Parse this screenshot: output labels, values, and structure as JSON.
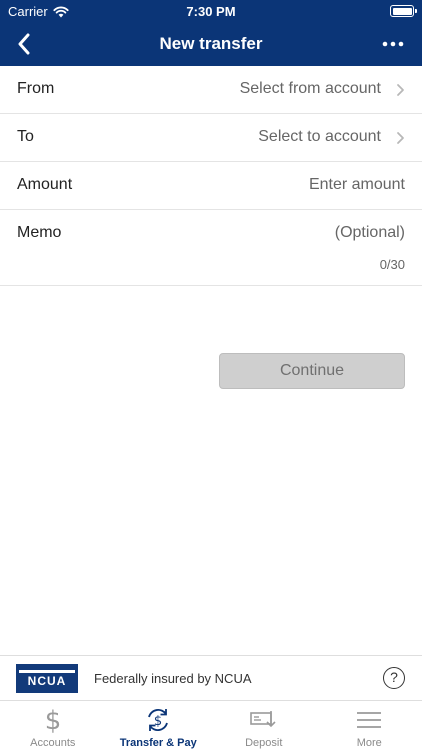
{
  "status_bar": {
    "carrier": "Carrier",
    "time": "7:30 PM"
  },
  "header": {
    "title": "New transfer",
    "back_icon": "chevron-left-icon",
    "more_icon": "more-dots-icon"
  },
  "form": {
    "from": {
      "label": "From",
      "value": "Select from account"
    },
    "to": {
      "label": "To",
      "value": "Select to account"
    },
    "amount": {
      "label": "Amount",
      "placeholder": "Enter amount"
    },
    "memo": {
      "label": "Memo",
      "placeholder": "(Optional)",
      "counter": "0/30"
    }
  },
  "continue_label": "Continue",
  "footer": {
    "logo": "NCUA",
    "insured_text": "Federally insured by NCUA",
    "help": "?"
  },
  "tabs": [
    {
      "label": "Accounts",
      "icon": "dollar-icon",
      "active": false
    },
    {
      "label": "Transfer & Pay",
      "icon": "transfer-dollar-icon",
      "active": true
    },
    {
      "label": "Deposit",
      "icon": "check-deposit-icon",
      "active": false
    },
    {
      "label": "More",
      "icon": "menu-icon",
      "active": false
    }
  ],
  "colors": {
    "brand": "#0b3577",
    "disabled_button": "#cfcfcf"
  }
}
